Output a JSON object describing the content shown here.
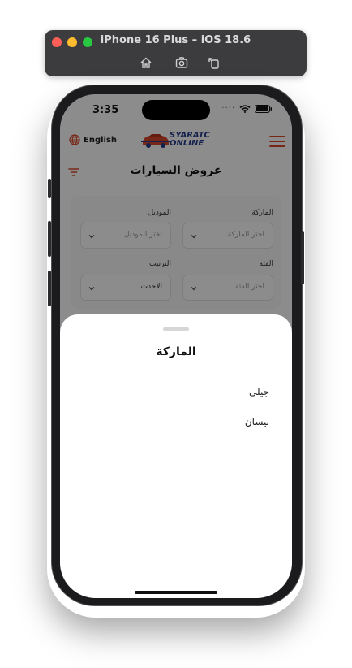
{
  "simulator": {
    "title": "iPhone 16 Plus – iOS 18.6",
    "buttons": [
      "home-icon",
      "screenshot-icon",
      "rotate-icon"
    ]
  },
  "status_bar": {
    "time": "3:35"
  },
  "header": {
    "language_label": "English",
    "logo_line1": "SYARATC",
    "logo_line2": "ONLINE",
    "page_title": "عروض السيارات"
  },
  "filters": {
    "brand": {
      "label": "الماركة",
      "placeholder": "اختر الماركة"
    },
    "model": {
      "label": "الموديل",
      "placeholder": "اختر الموديل"
    },
    "category": {
      "label": "الفئة",
      "placeholder": "اختر الفئة"
    },
    "sort": {
      "label": "الترتيب",
      "value": "الاحدث"
    }
  },
  "sheet": {
    "title": "الماركة",
    "options": [
      "جيلي",
      "نيسان"
    ]
  },
  "colors": {
    "accent": "#d9472b",
    "brand_blue": "#233a8c",
    "overlay": "rgba(0,0,0,0.45)"
  }
}
